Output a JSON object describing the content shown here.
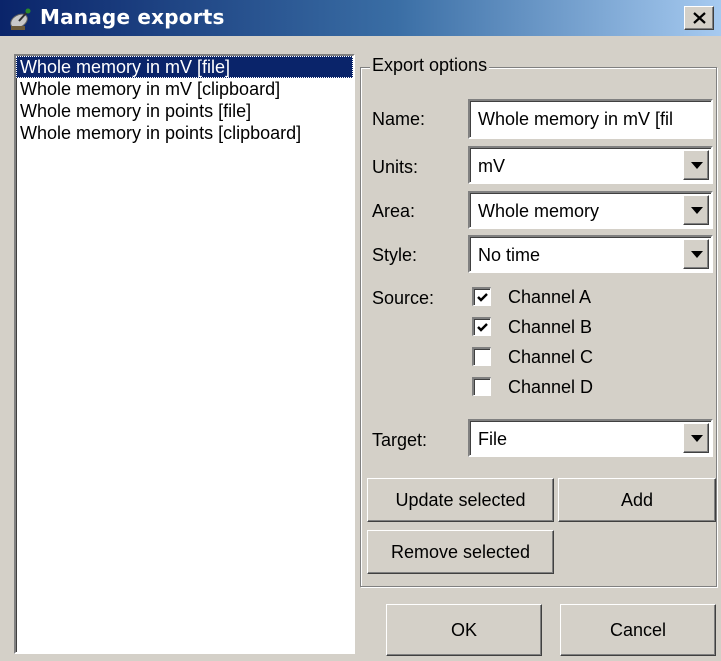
{
  "window": {
    "title": "Manage exports",
    "close_symbol": "×"
  },
  "exports_list": {
    "items": [
      {
        "label": "Whole memory in mV [file]",
        "selected": true
      },
      {
        "label": "Whole memory in mV [clipboard]",
        "selected": false
      },
      {
        "label": "Whole memory in points [file]",
        "selected": false
      },
      {
        "label": "Whole memory in points [clipboard]",
        "selected": false
      }
    ]
  },
  "export_options": {
    "legend": "Export options",
    "name": {
      "label": "Name:",
      "value": "Whole memory in mV [fil"
    },
    "units": {
      "label": "Units:",
      "value": "mV"
    },
    "area": {
      "label": "Area:",
      "value": "Whole memory"
    },
    "style": {
      "label": "Style:",
      "value": "No time"
    },
    "source": {
      "label": "Source:",
      "channels": [
        {
          "label": "Channel A",
          "checked": true
        },
        {
          "label": "Channel B",
          "checked": true
        },
        {
          "label": "Channel C",
          "checked": false
        },
        {
          "label": "Channel D",
          "checked": false
        }
      ]
    },
    "target": {
      "label": "Target:",
      "value": "File"
    }
  },
  "buttons": {
    "update_selected": "Update selected",
    "add": "Add",
    "remove_selected": "Remove selected",
    "ok": "OK",
    "cancel": "Cancel"
  },
  "icons": {
    "title_icon": "satellite-dish-icon",
    "close": "close-icon",
    "dropdown": "chevron-down-icon",
    "check": "checkmark-icon"
  }
}
